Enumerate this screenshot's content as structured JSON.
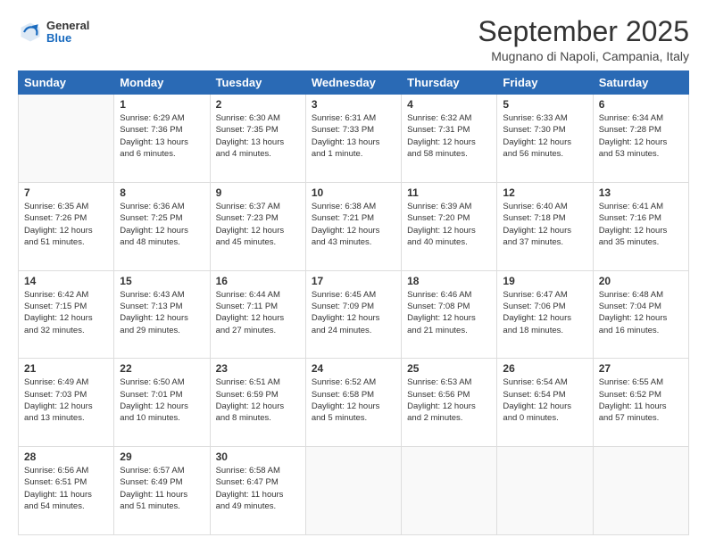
{
  "header": {
    "logo": {
      "general": "General",
      "blue": "Blue"
    },
    "title": "September 2025",
    "location": "Mugnano di Napoli, Campania, Italy"
  },
  "days_of_week": [
    "Sunday",
    "Monday",
    "Tuesday",
    "Wednesday",
    "Thursday",
    "Friday",
    "Saturday"
  ],
  "weeks": [
    [
      {
        "day": "",
        "info": ""
      },
      {
        "day": "1",
        "info": "Sunrise: 6:29 AM\nSunset: 7:36 PM\nDaylight: 13 hours\nand 6 minutes."
      },
      {
        "day": "2",
        "info": "Sunrise: 6:30 AM\nSunset: 7:35 PM\nDaylight: 13 hours\nand 4 minutes."
      },
      {
        "day": "3",
        "info": "Sunrise: 6:31 AM\nSunset: 7:33 PM\nDaylight: 13 hours\nand 1 minute."
      },
      {
        "day": "4",
        "info": "Sunrise: 6:32 AM\nSunset: 7:31 PM\nDaylight: 12 hours\nand 58 minutes."
      },
      {
        "day": "5",
        "info": "Sunrise: 6:33 AM\nSunset: 7:30 PM\nDaylight: 12 hours\nand 56 minutes."
      },
      {
        "day": "6",
        "info": "Sunrise: 6:34 AM\nSunset: 7:28 PM\nDaylight: 12 hours\nand 53 minutes."
      }
    ],
    [
      {
        "day": "7",
        "info": "Sunrise: 6:35 AM\nSunset: 7:26 PM\nDaylight: 12 hours\nand 51 minutes."
      },
      {
        "day": "8",
        "info": "Sunrise: 6:36 AM\nSunset: 7:25 PM\nDaylight: 12 hours\nand 48 minutes."
      },
      {
        "day": "9",
        "info": "Sunrise: 6:37 AM\nSunset: 7:23 PM\nDaylight: 12 hours\nand 45 minutes."
      },
      {
        "day": "10",
        "info": "Sunrise: 6:38 AM\nSunset: 7:21 PM\nDaylight: 12 hours\nand 43 minutes."
      },
      {
        "day": "11",
        "info": "Sunrise: 6:39 AM\nSunset: 7:20 PM\nDaylight: 12 hours\nand 40 minutes."
      },
      {
        "day": "12",
        "info": "Sunrise: 6:40 AM\nSunset: 7:18 PM\nDaylight: 12 hours\nand 37 minutes."
      },
      {
        "day": "13",
        "info": "Sunrise: 6:41 AM\nSunset: 7:16 PM\nDaylight: 12 hours\nand 35 minutes."
      }
    ],
    [
      {
        "day": "14",
        "info": "Sunrise: 6:42 AM\nSunset: 7:15 PM\nDaylight: 12 hours\nand 32 minutes."
      },
      {
        "day": "15",
        "info": "Sunrise: 6:43 AM\nSunset: 7:13 PM\nDaylight: 12 hours\nand 29 minutes."
      },
      {
        "day": "16",
        "info": "Sunrise: 6:44 AM\nSunset: 7:11 PM\nDaylight: 12 hours\nand 27 minutes."
      },
      {
        "day": "17",
        "info": "Sunrise: 6:45 AM\nSunset: 7:09 PM\nDaylight: 12 hours\nand 24 minutes."
      },
      {
        "day": "18",
        "info": "Sunrise: 6:46 AM\nSunset: 7:08 PM\nDaylight: 12 hours\nand 21 minutes."
      },
      {
        "day": "19",
        "info": "Sunrise: 6:47 AM\nSunset: 7:06 PM\nDaylight: 12 hours\nand 18 minutes."
      },
      {
        "day": "20",
        "info": "Sunrise: 6:48 AM\nSunset: 7:04 PM\nDaylight: 12 hours\nand 16 minutes."
      }
    ],
    [
      {
        "day": "21",
        "info": "Sunrise: 6:49 AM\nSunset: 7:03 PM\nDaylight: 12 hours\nand 13 minutes."
      },
      {
        "day": "22",
        "info": "Sunrise: 6:50 AM\nSunset: 7:01 PM\nDaylight: 12 hours\nand 10 minutes."
      },
      {
        "day": "23",
        "info": "Sunrise: 6:51 AM\nSunset: 6:59 PM\nDaylight: 12 hours\nand 8 minutes."
      },
      {
        "day": "24",
        "info": "Sunrise: 6:52 AM\nSunset: 6:58 PM\nDaylight: 12 hours\nand 5 minutes."
      },
      {
        "day": "25",
        "info": "Sunrise: 6:53 AM\nSunset: 6:56 PM\nDaylight: 12 hours\nand 2 minutes."
      },
      {
        "day": "26",
        "info": "Sunrise: 6:54 AM\nSunset: 6:54 PM\nDaylight: 12 hours\nand 0 minutes."
      },
      {
        "day": "27",
        "info": "Sunrise: 6:55 AM\nSunset: 6:52 PM\nDaylight: 11 hours\nand 57 minutes."
      }
    ],
    [
      {
        "day": "28",
        "info": "Sunrise: 6:56 AM\nSunset: 6:51 PM\nDaylight: 11 hours\nand 54 minutes."
      },
      {
        "day": "29",
        "info": "Sunrise: 6:57 AM\nSunset: 6:49 PM\nDaylight: 11 hours\nand 51 minutes."
      },
      {
        "day": "30",
        "info": "Sunrise: 6:58 AM\nSunset: 6:47 PM\nDaylight: 11 hours\nand 49 minutes."
      },
      {
        "day": "",
        "info": ""
      },
      {
        "day": "",
        "info": ""
      },
      {
        "day": "",
        "info": ""
      },
      {
        "day": "",
        "info": ""
      }
    ]
  ]
}
